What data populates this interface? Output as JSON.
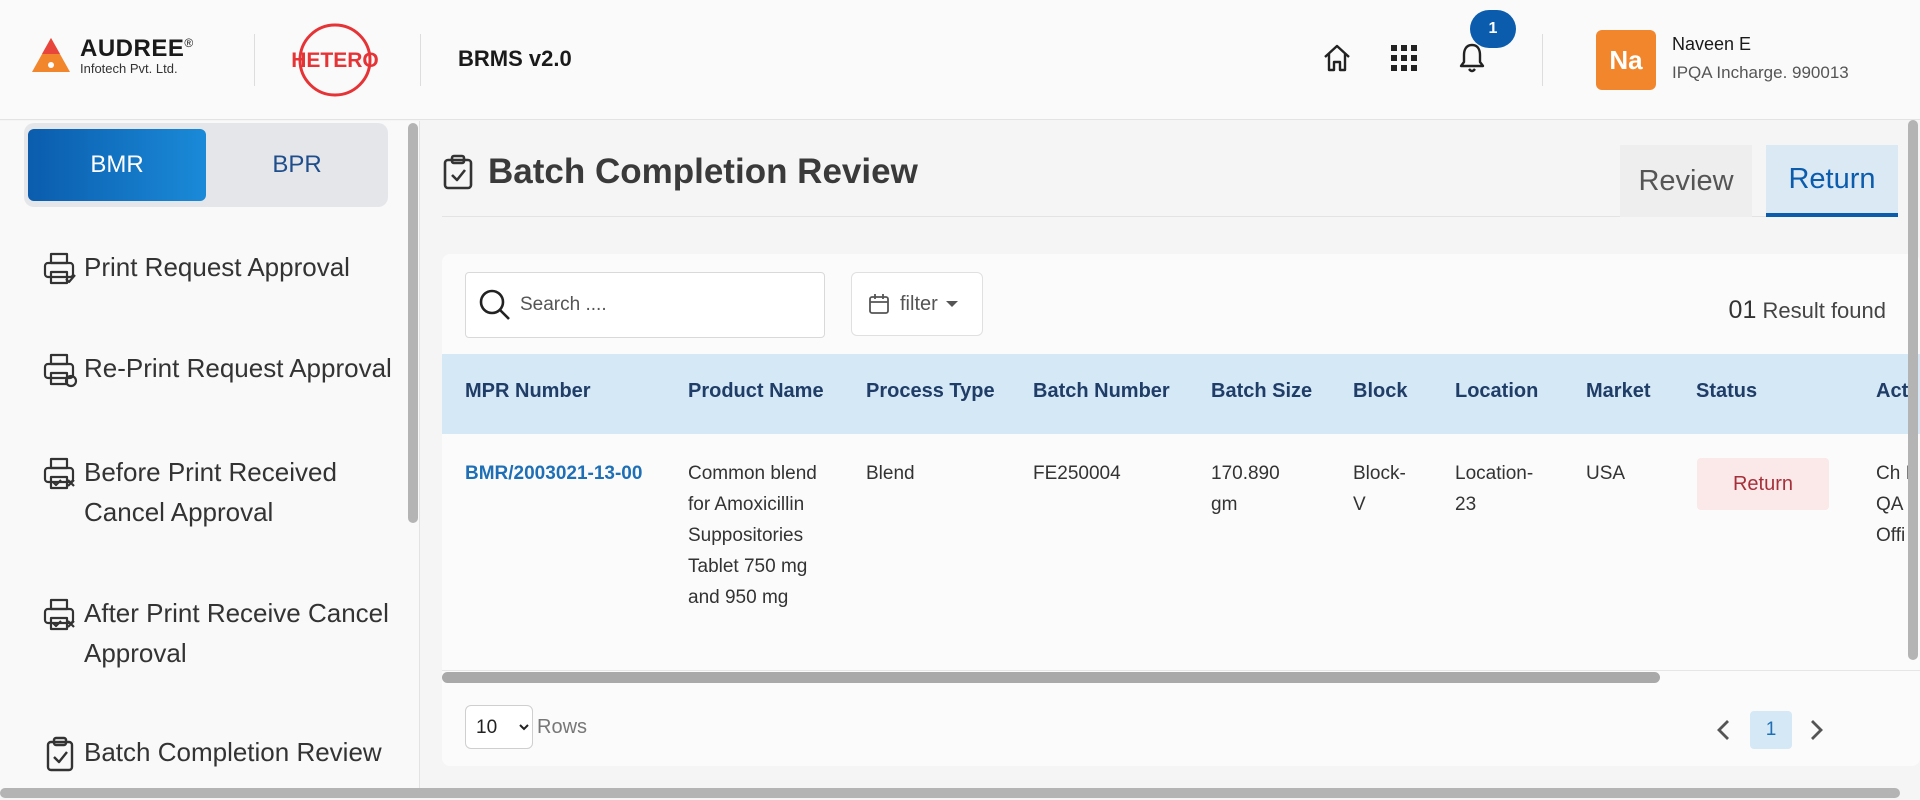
{
  "header": {
    "company_name": "AUDREE",
    "company_reg": "®",
    "company_sub": "Infotech Pvt. Ltd.",
    "client_logo_text": "HETERO",
    "app_title": "BRMS v2.0",
    "notification_count": "1",
    "user": {
      "initials": "Na",
      "name": "Naveen E",
      "role": "IPQA Incharge. 990013"
    },
    "icons": [
      "home-icon",
      "apps-grid-icon",
      "bell-icon"
    ],
    "colors": {
      "brand_blue": "#0b5cad",
      "avatar_orange": "#f2862d",
      "hetero_red": "#e63336"
    }
  },
  "sidebar": {
    "toggle": {
      "active": "BMR",
      "inactive": "BPR"
    },
    "items": [
      {
        "label": "Print Request Approval",
        "icon": "printer-check-icon"
      },
      {
        "label": "Re-Print Request Approval",
        "icon": "printer-refresh-icon"
      },
      {
        "label": "Before Print Received Cancel Approval",
        "icon": "printer-cancel-icon"
      },
      {
        "label": "After Print Receive Cancel Approval",
        "icon": "printer-cancel-icon"
      },
      {
        "label": "Batch Completion Review",
        "icon": "clipboard-check-icon"
      }
    ]
  },
  "main": {
    "title": "Batch Completion Review",
    "tabs": [
      {
        "label": "Review"
      },
      {
        "label": "Return"
      }
    ],
    "active_tab": "Return",
    "search": {
      "placeholder": "Search ....",
      "value": ""
    },
    "filter_label": "filter",
    "result": {
      "count": "01",
      "text": " Result found"
    },
    "table": {
      "columns": [
        "MPR Number",
        "Product Name",
        "Process Type",
        "Batch Number",
        "Batch Size",
        "Block",
        "Location",
        "Market",
        "Status",
        "Acti"
      ],
      "rows": [
        {
          "mpr_number": "BMR/2003021-13-00",
          "product_name": "Common blend for Amoxicillin Suppositories Tablet 750 mg and 950 mg",
          "process_type": "Blend",
          "batch_number": "FE250004",
          "batch_size": "170.890 gm",
          "block": "Block-V",
          "location": "Location-23",
          "market": "USA",
          "status": "Return",
          "action": "Ch I QA Offi"
        }
      ]
    },
    "pagination": {
      "rows_per_page": "10",
      "rows_label": "Rows",
      "current_page": "1"
    }
  }
}
